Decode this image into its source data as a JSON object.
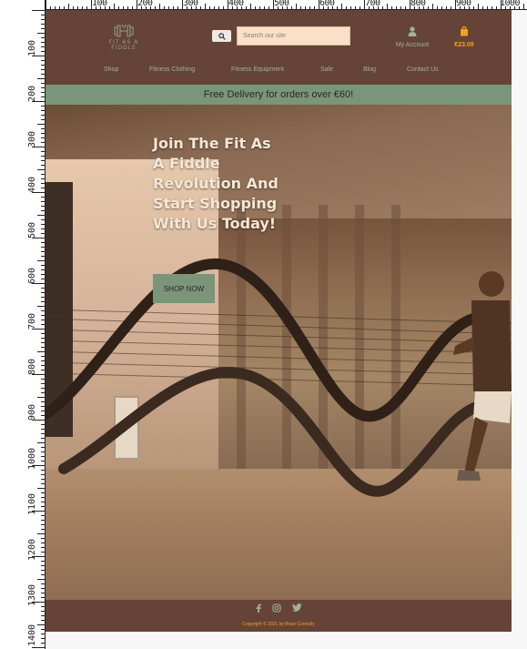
{
  "ruler": {
    "top_labels": [
      "100",
      "200",
      "300",
      "400",
      "500",
      "600",
      "700",
      "800",
      "900",
      "1000"
    ],
    "left_labels": [
      "100",
      "200",
      "300",
      "400",
      "500",
      "600",
      "700",
      "800",
      "900",
      "1000",
      "1100",
      "1200",
      "1300",
      "1400"
    ]
  },
  "header": {
    "logo_text": "FIT AS A\nFIDDLE",
    "search_placeholder": "Search our site",
    "account_label": "My Account",
    "bag_total": "€23.09"
  },
  "nav": {
    "items": [
      "Shop",
      "Fitness Clothing",
      "Fitness Equipment",
      "Sale",
      "Blog",
      "Contact Us"
    ]
  },
  "banner": {
    "text": "Free Delivery for orders over €60!"
  },
  "hero": {
    "title": "Join The Fit As A Fiddle Revolution And Start Shopping With Us Today!",
    "cta_label": "SHOP NOW"
  },
  "footer": {
    "social_icons": [
      "facebook-icon",
      "instagram-icon",
      "twitter-icon"
    ],
    "copyright": "Copyright © 2021 by Brian Connolly"
  },
  "colors": {
    "brand_brown": "#664337",
    "brand_green": "#7a957a",
    "accent_orange": "#f3a21a",
    "search_bg": "#fbe0c8"
  }
}
